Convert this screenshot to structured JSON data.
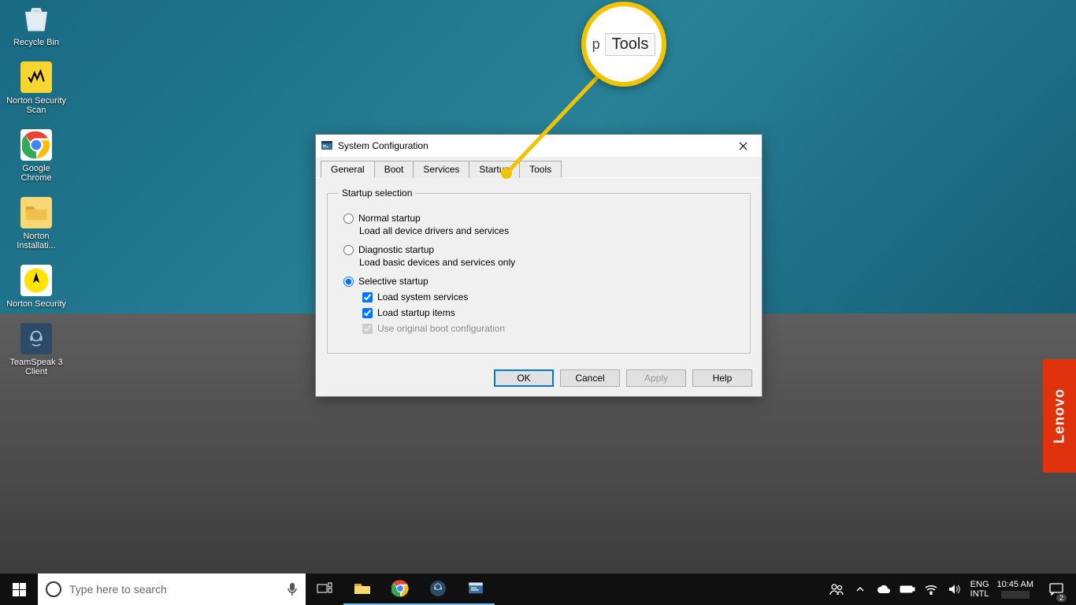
{
  "desktop": {
    "icons": [
      {
        "label": "Recycle Bin",
        "kind": "recycle-bin-icon"
      },
      {
        "label": "Norton Security Scan",
        "kind": "norton-scan-icon"
      },
      {
        "label": "Google Chrome",
        "kind": "chrome-icon"
      },
      {
        "label": "Norton Installati...",
        "kind": "folder-icon"
      },
      {
        "label": "Norton Security",
        "kind": "norton-security-icon"
      },
      {
        "label": "TeamSpeak 3 Client",
        "kind": "teamspeak-icon"
      }
    ]
  },
  "lenovo_label": "Lenovo",
  "dialog": {
    "title": "System Configuration",
    "tabs": [
      "General",
      "Boot",
      "Services",
      "Startup",
      "Tools"
    ],
    "active_tab": 0,
    "fieldset_legend": "Startup selection",
    "options": [
      {
        "label": "Normal startup",
        "desc": "Load all device drivers and services",
        "checked": false
      },
      {
        "label": "Diagnostic startup",
        "desc": "Load basic devices and services only",
        "checked": false
      },
      {
        "label": "Selective startup",
        "desc": "",
        "checked": true
      }
    ],
    "suboptions": [
      {
        "label": "Load system services",
        "checked": true,
        "disabled": false
      },
      {
        "label": "Load startup items",
        "checked": true,
        "disabled": false
      },
      {
        "label": "Use original boot configuration",
        "checked": true,
        "disabled": true
      }
    ],
    "buttons": {
      "ok": "OK",
      "cancel": "Cancel",
      "apply": "Apply",
      "help": "Help"
    }
  },
  "callout": {
    "partial": "p",
    "highlight": "Tools"
  },
  "taskbar": {
    "search_placeholder": "Type here to search",
    "lang_top": "ENG",
    "lang_bottom": "INTL",
    "time": "10:45 AM",
    "notif_count": "2"
  }
}
